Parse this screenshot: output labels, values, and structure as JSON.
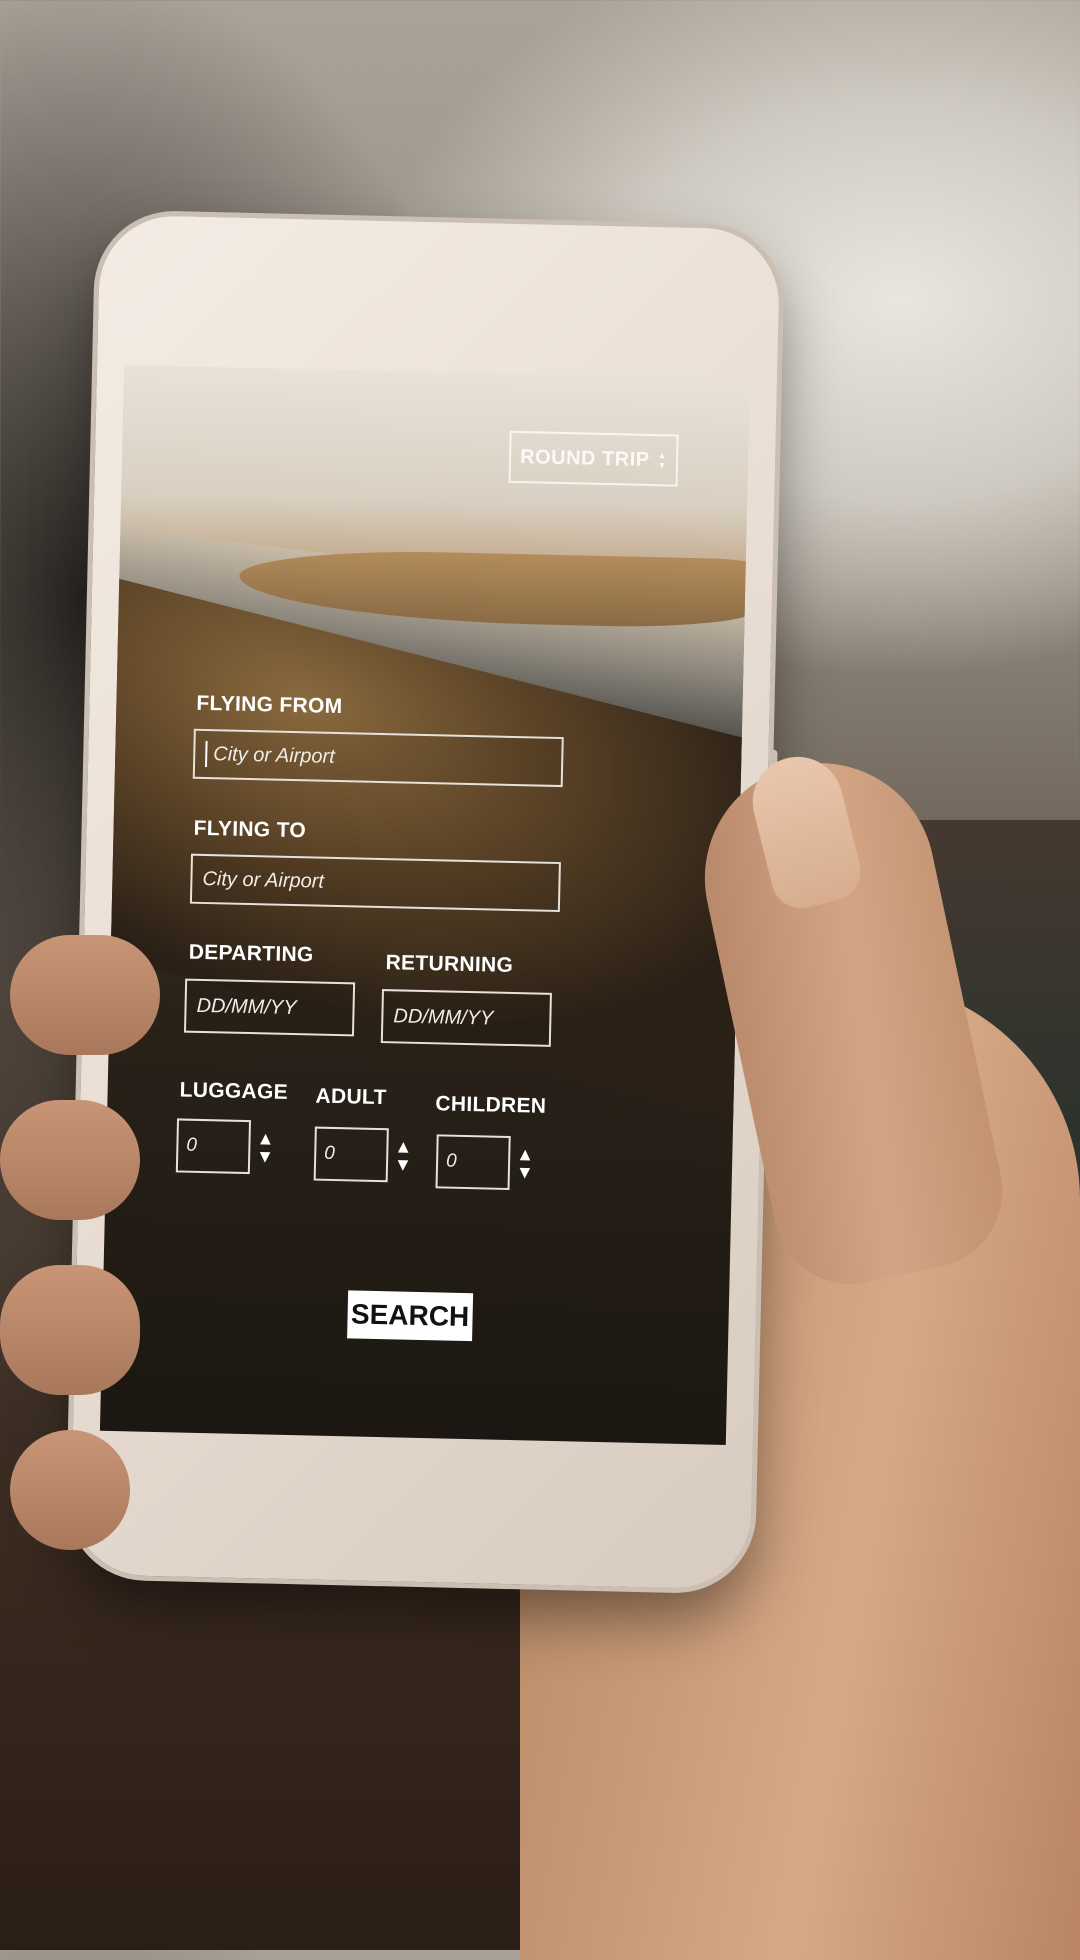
{
  "app": {
    "trip_type": "ROUND TRIP",
    "flying_from": {
      "label": "FLYING FROM",
      "placeholder": "City or Airport"
    },
    "flying_to": {
      "label": "FLYING TO",
      "placeholder": "City or Airport"
    },
    "departing": {
      "label": "DEPARTING",
      "placeholder": "DD/MM/YY"
    },
    "returning": {
      "label": "RETURNING",
      "placeholder": "DD/MM/YY"
    },
    "luggage": {
      "label": "LUGGAGE",
      "value": "0"
    },
    "adult": {
      "label": "ADULT",
      "value": "0"
    },
    "children": {
      "label": "CHILDREN",
      "value": "0"
    },
    "search_label": "SEARCH"
  },
  "icons": {
    "spinner_up": "▲",
    "spinner_down": "▼"
  },
  "colors": {
    "field_border": "#e6e1da",
    "button_bg": "#ffffff",
    "button_text": "#111111",
    "phone_body": "#efe5dc"
  }
}
